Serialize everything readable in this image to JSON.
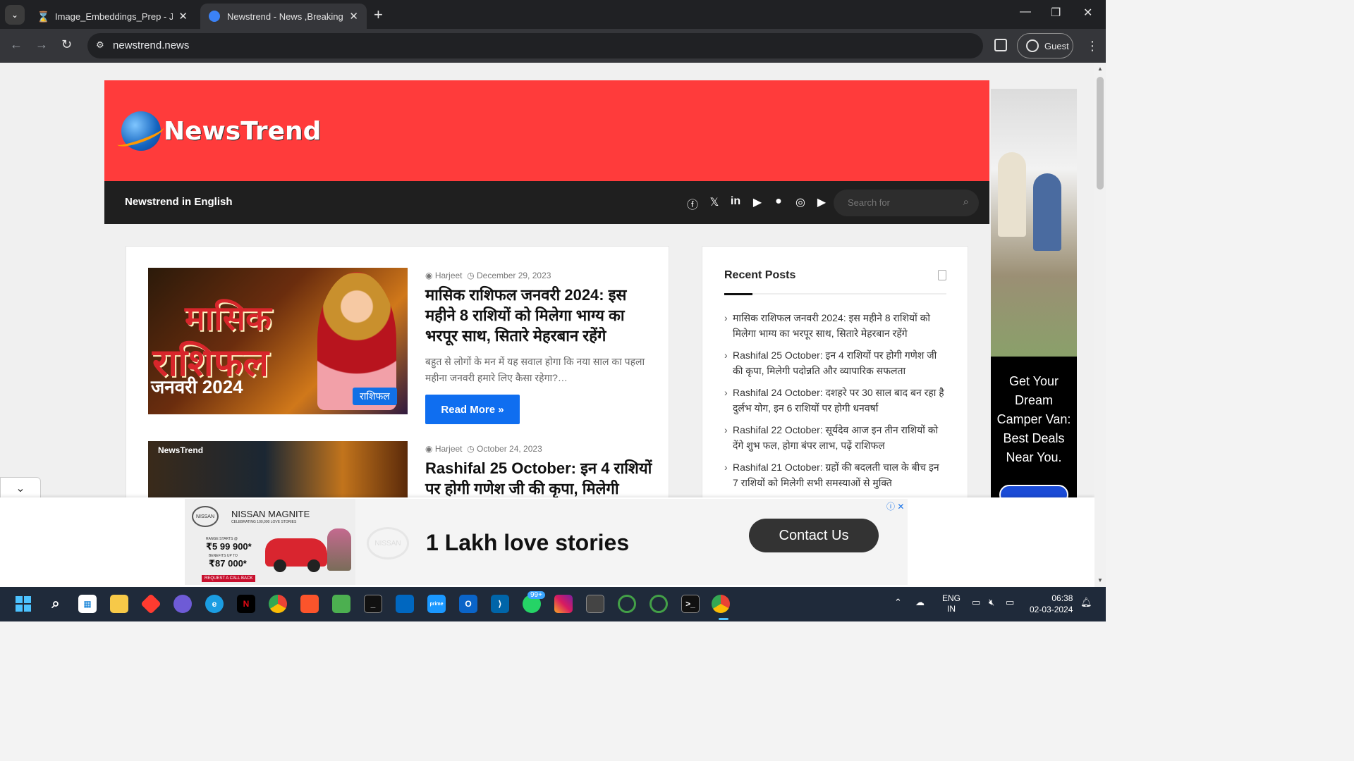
{
  "browser": {
    "tabs": [
      {
        "title": "Image_Embeddings_Prep - Jupy",
        "active": false
      },
      {
        "title": "Newstrend - News ,Breaking Ne",
        "active": true
      }
    ],
    "url": "newstrend.news",
    "profile_label": "Guest"
  },
  "site": {
    "logo_text": "NewsTrend",
    "nav_brand": "Newstrend in English",
    "search_placeholder": "Search for",
    "social_icons": [
      "facebook-icon",
      "x-icon",
      "linkedin-icon",
      "youtube-icon",
      "apple-icon",
      "instagram-icon",
      "play-icon"
    ],
    "accent_color": "#ff3b3b",
    "nav_color": "#1f1f1f"
  },
  "posts": [
    {
      "author": "Harjeet",
      "date": "December 29, 2023",
      "title": "मासिक राशिफल जनवरी 2024: इस महीने 8 राशियों को मिलेगा भाग्य का भरपूर साथ, सितारे मेहरबान रहेंगे",
      "excerpt": "बहुत से लोगों के मन में यह सवाल होगा कि नया साल का पहला महीना जनवरी हमारे लिए कैसा रहेगा?…",
      "category": "राशिफल",
      "read_more": "Read More »",
      "thumb_line1": "मासिक",
      "thumb_line2": "राशिफल",
      "thumb_line3": "जनवरी 2024"
    },
    {
      "author": "Harjeet",
      "date": "October 24, 2023",
      "title": "Rashifal 25 October: इन 4 राशियों पर होगी गणेश जी की कृपा, मिलेगी",
      "thumb_label": "NewsTrend"
    }
  ],
  "sidebar": {
    "heading": "Recent Posts",
    "items": [
      "मासिक राशिफल जनवरी 2024: इस महीने 8 राशियों को मिलेगा भाग्य का भरपूर साथ, सितारे मेहरबान रहेंगे",
      "Rashifal 25 October: इन 4 राशियों पर होगी गणेश जी की कृपा, मिलेगी पदोन्नति और व्यापारिक सफलता",
      "Rashifal 24 October: दशहरे पर 30 साल बाद बन रहा है दुर्लभ योग, इन 6 राशियों पर होगी धनवर्षा",
      "Rashifal 22 October: सूर्यदेव आज इन तीन राशियों को देंगे शुभ फल, होगा बंपर लाभ, पढ़ें राशिफल",
      "Rashifal 21 October: ग्रहों की बदलती चाल के बीच इन 7 राशियों को मिलेगी सभी समस्याओं से मुक्ति"
    ]
  },
  "ad_side": {
    "text": "Get Your Dream Camper Van: Best Deals Near You."
  },
  "ad_bottom": {
    "brand": "NISSAN",
    "title": "NISSAN MAGNITE",
    "subtitle": "CELEBRATING 100,000 LOVE STORIES",
    "range_label": "RANGE STARTS @",
    "price": "₹5 99 900*",
    "benefits_label": "BENEFITS UP TO",
    "benefits": "₹87 000*",
    "cta_small": "REQUEST A CALL BACK",
    "headline": "1 Lakh love stories",
    "cta": "Contact Us"
  },
  "taskbar": {
    "lang_line1": "ENG",
    "lang_line2": "IN",
    "time": "06:38",
    "date": "02-03-2024",
    "whatsapp_badge": "99+"
  }
}
